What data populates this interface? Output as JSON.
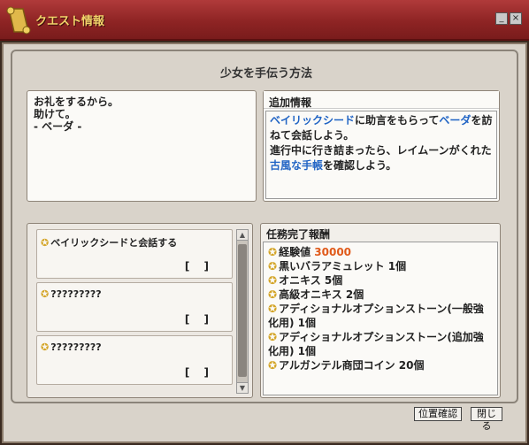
{
  "window": {
    "title": "クエスト情報",
    "min_label": "_",
    "close_label": "×"
  },
  "quest": {
    "title": "少女を手伝う方法",
    "description": [
      "お礼をするから。",
      "助けて。",
      "- ベーダ -"
    ]
  },
  "info": {
    "heading": "追加情報",
    "line1_pre": "",
    "line1_hl1": "ベイリックシード",
    "line1_mid": "に助言をもらって",
    "line1_hl2": "ベーダ",
    "line1_post": "を訪",
    "line2": "ねて会話しよう。",
    "line3": "進行中に行き詰まったら、レイムーンがくれた",
    "line4_hl": "古風な手帳",
    "line4_post": "を確認しよう。"
  },
  "objectives": [
    {
      "name": "ベイリックシードと会話する",
      "status": "[ ]"
    },
    {
      "name": "?????????",
      "status": "[ ]"
    },
    {
      "name": "?????????",
      "status": "[ ]"
    }
  ],
  "rewards": {
    "heading": "任務完了報酬",
    "items": [
      {
        "label": "経験値",
        "value": "30000"
      },
      {
        "label": "黒いバラアミュレット 1個"
      },
      {
        "label": "オニキス 5個"
      },
      {
        "label": "高級オニキス 2個"
      },
      {
        "label": "アディショナルオプションストーン(一般強化用) 1個"
      },
      {
        "label": "アディショナルオプションストーン(追加強化用) 1個"
      },
      {
        "label": "アルガンテル商団コイン 20個"
      }
    ]
  },
  "buttons": {
    "position": "位置確認",
    "close": "閉じる"
  },
  "colors": {
    "title_bar": "#8e2424",
    "title_text": "#f2d36a",
    "highlight": "#1f63c4",
    "exp": "#e05a1a",
    "star": "#d4a528"
  }
}
